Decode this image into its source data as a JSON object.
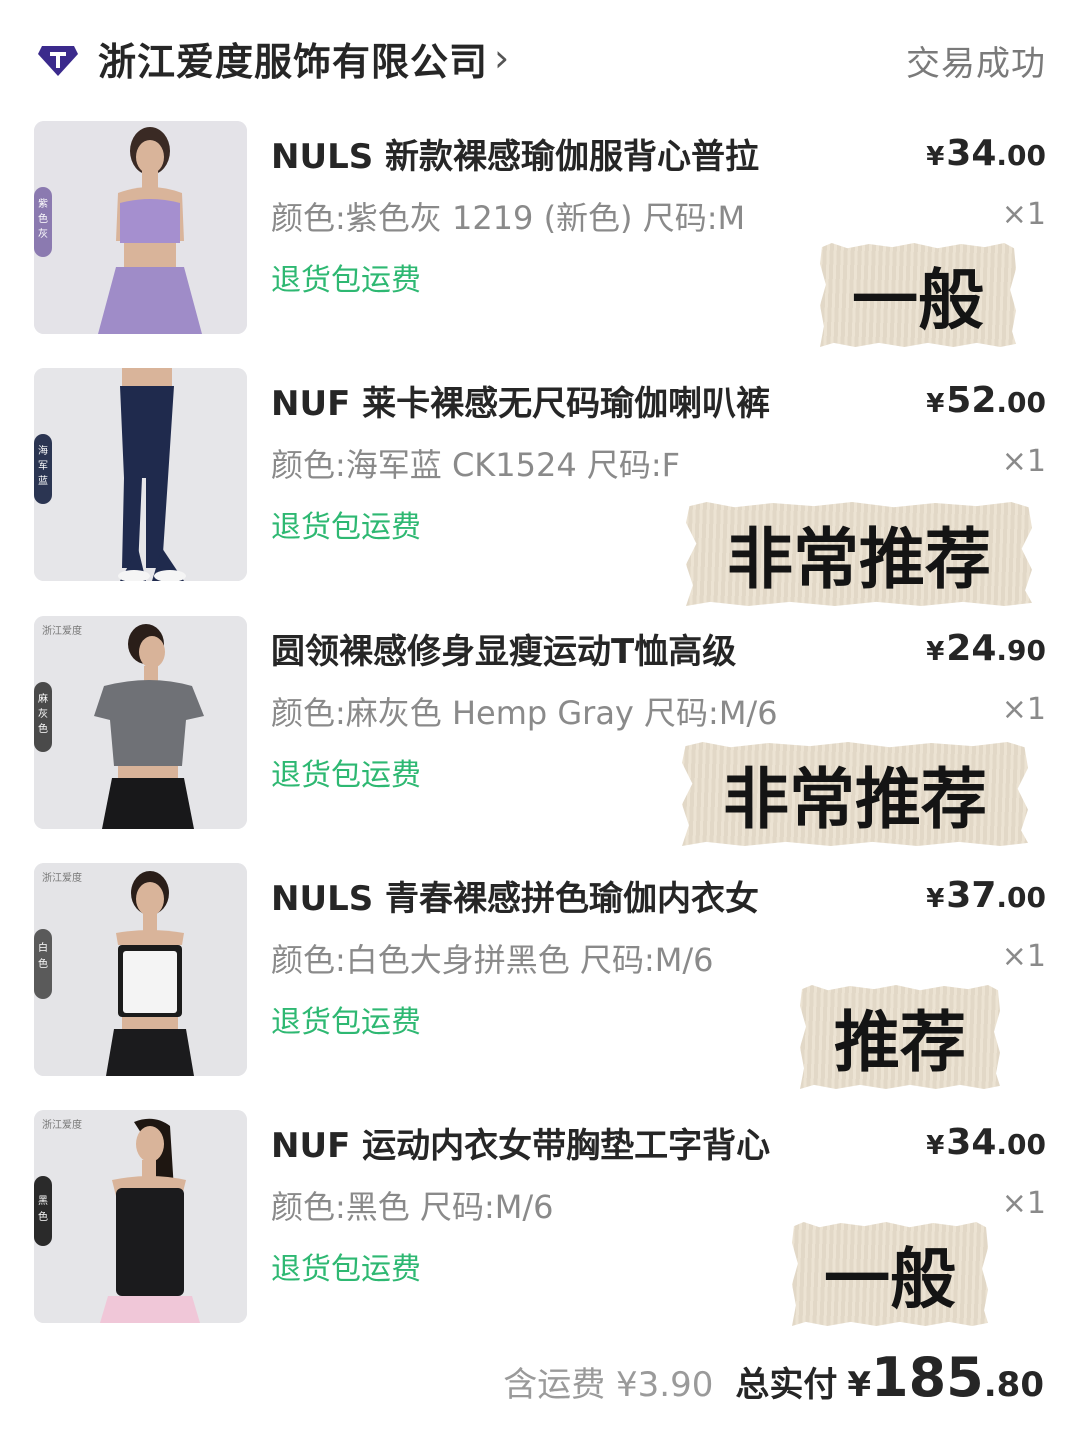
{
  "store": {
    "name": "浙江爱度服饰有限公司",
    "chevron": "›",
    "status": "交易成功",
    "logo_icon": "store-diamond-logo",
    "logo_color": "#3b2a8c"
  },
  "items": [
    {
      "title": "NULS 新款裸感瑜伽服背心普拉",
      "spec": "颜色:紫色灰 1219 (新色) 尺码:M",
      "badge": "退货包运费",
      "price_yen": "¥",
      "price_int": "34",
      "price_dec": ".00",
      "qty": "×1",
      "tag": "一般",
      "color_tab": "紫色灰",
      "garment_color": "#a58fcf"
    },
    {
      "title": "NUF 莱卡裸感无尺码瑜伽喇叭裤",
      "spec": "颜色:海军蓝  CK1524 尺码:F",
      "badge": "退货包运费",
      "price_yen": "¥",
      "price_int": "52",
      "price_dec": ".00",
      "qty": "×1",
      "tag": "非常推荐",
      "color_tab": "海军蓝",
      "garment_color": "#1f2a4d"
    },
    {
      "title": "圆领裸感修身显瘦运动T恤高级",
      "spec": "颜色:麻灰色 Hemp Gray 尺码:M/6",
      "badge": "退货包运费",
      "price_yen": "¥",
      "price_int": "24",
      "price_dec": ".90",
      "qty": "×1",
      "tag": "非常推荐",
      "color_tab": "麻灰色",
      "brand_watermark": "浙江爱度",
      "garment_color": "#6f7176"
    },
    {
      "title": "NULS 青春裸感拼色瑜伽内衣女",
      "spec": "颜色:白色大身拼黑色 尺码:M/6",
      "badge": "退货包运费",
      "price_yen": "¥",
      "price_int": "37",
      "price_dec": ".00",
      "qty": "×1",
      "tag": "推荐",
      "color_tab": "白色",
      "brand_watermark": "浙江爱度",
      "garment_color": "#f4f4f4"
    },
    {
      "title": "NUF 运动内衣女带胸垫工字背心",
      "spec": "颜色:黑色 尺码:M/6",
      "badge": "退货包运费",
      "price_yen": "¥",
      "price_int": "34",
      "price_dec": ".00",
      "qty": "×1",
      "tag": "一般",
      "color_tab": "黑色",
      "brand_watermark": "浙江爱度",
      "garment_color": "#1b1b1d"
    }
  ],
  "footer": {
    "shipping": "含运费 ¥3.90",
    "total_label": "总实付",
    "total_yen": "¥",
    "total_int": "185",
    "total_dec": ".80"
  },
  "colors": {
    "badge_green": "#2eb872",
    "tape_beige": "#e9dfcd"
  }
}
